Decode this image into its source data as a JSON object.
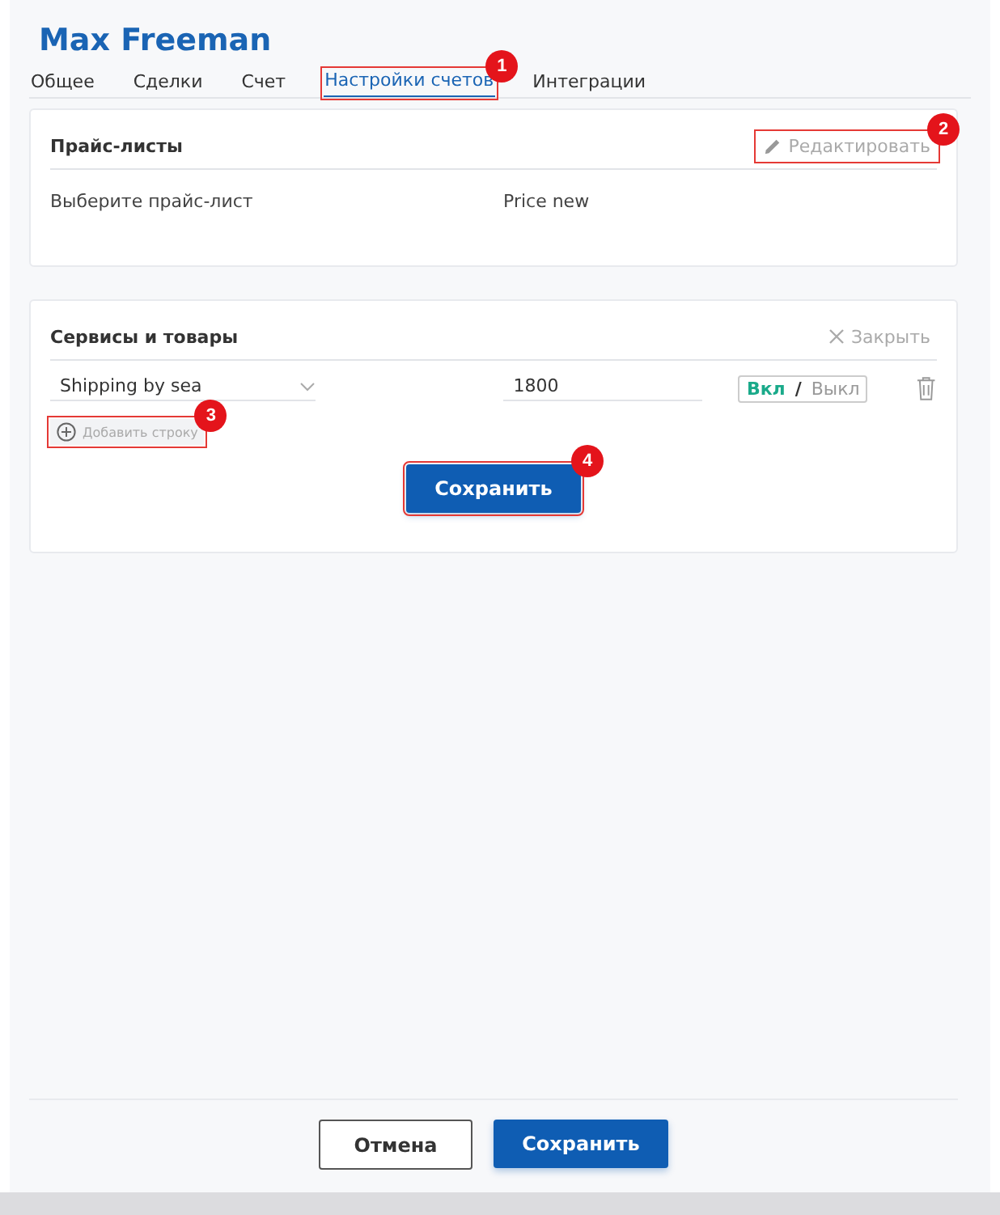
{
  "header": {
    "title": "Max Freeman"
  },
  "tabs": [
    {
      "label": "Общее",
      "selected": false
    },
    {
      "label": "Сделки",
      "selected": false
    },
    {
      "label": "Счет",
      "selected": false
    },
    {
      "label": "Настройки счетов",
      "selected": true,
      "callout": "1"
    },
    {
      "label": "Интеграции",
      "selected": false
    }
  ],
  "price_lists": {
    "title": "Прайс-листы",
    "edit_button": {
      "label": "Редактировать",
      "callout": "2"
    },
    "field_label": "Выберите прайс-лист",
    "field_value": "Price new"
  },
  "services": {
    "title": "Сервисы и товары",
    "close_button": "Закрыть",
    "rows": [
      {
        "product": "Shipping by sea",
        "price": "1800",
        "on_label": "Вкл",
        "separator": "/",
        "off_label": "Выкл",
        "on": true
      }
    ],
    "add_row": {
      "label": "Добавить строку",
      "callout": "3"
    },
    "save_button": {
      "label": "Сохранить",
      "callout": "4"
    }
  },
  "footer": {
    "buttons": [
      {
        "label": "Отмена",
        "kind": "secondary"
      },
      {
        "label": "Сохранить",
        "kind": "primary"
      }
    ]
  }
}
